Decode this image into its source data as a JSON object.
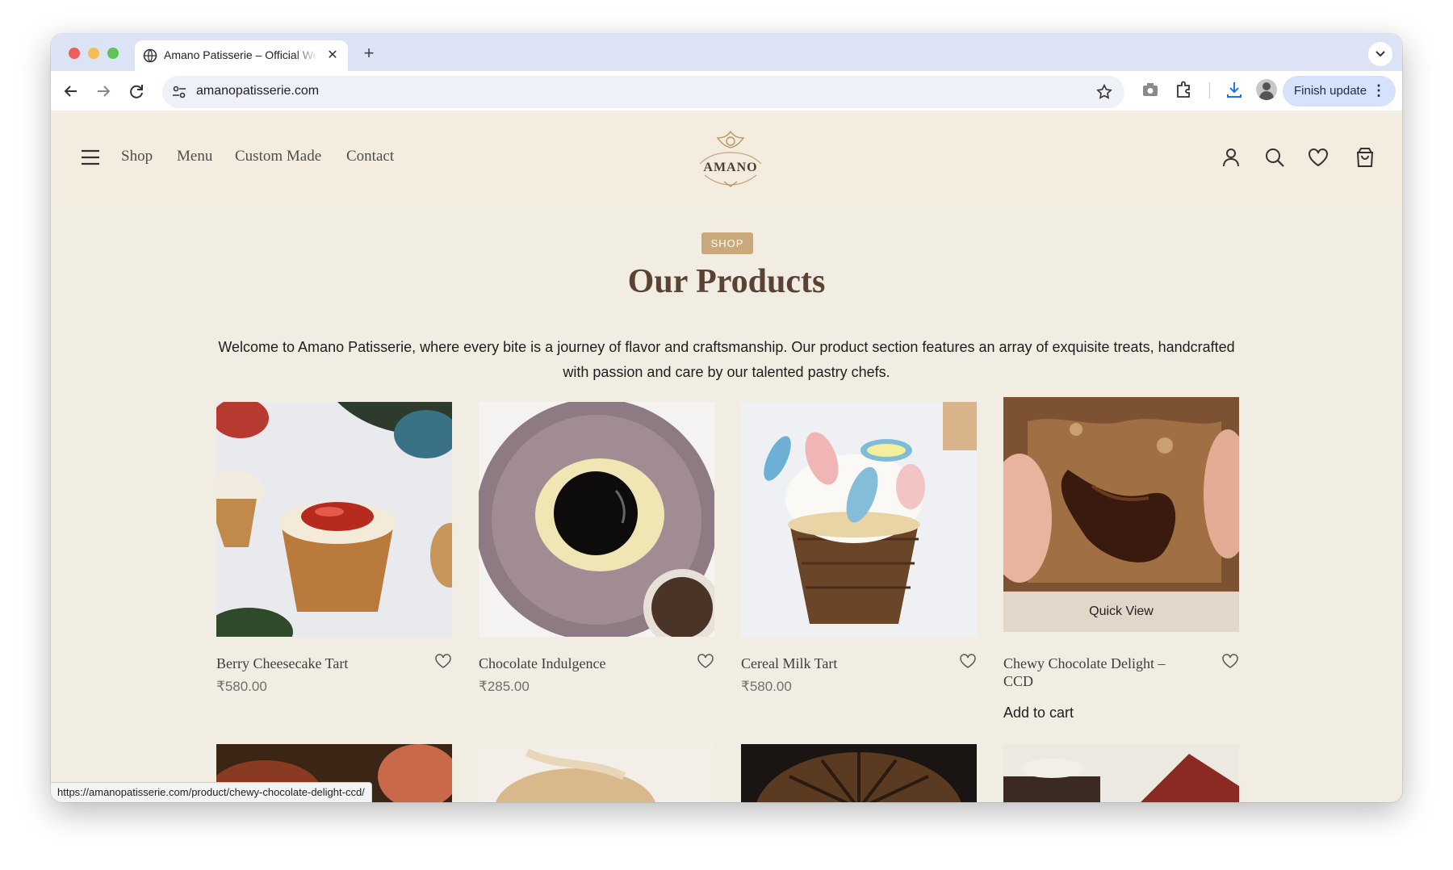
{
  "browser": {
    "tab_title": "Amano Patisserie – Official Website",
    "url": "amanopatisserie.com",
    "finish_update_label": "Finish update",
    "status_url": "https://amanopatisserie.com/product/chewy-chocolate-delight-ccd/"
  },
  "site": {
    "nav": [
      "Shop",
      "Menu",
      "Custom Made",
      "Contact"
    ],
    "logo_text": "AMANO",
    "header_icons": [
      "account-icon",
      "search-icon",
      "wishlist-heart-icon",
      "shopping-bag-icon"
    ]
  },
  "main": {
    "badge": "SHOP",
    "title": "Our Products",
    "intro": "Welcome to Amano Patisserie, where every bite is a journey of flavor and craftsmanship. Our product section features an array of exquisite treats, handcrafted with passion and care by our talented pastry chefs.",
    "quick_view_label": "Quick View",
    "products": [
      {
        "name": "Berry Cheesecake Tart",
        "price": "₹580.00"
      },
      {
        "name": "Chocolate Indulgence",
        "price": "₹285.00"
      },
      {
        "name": "Cereal Milk Tart",
        "price": "₹580.00"
      },
      {
        "name": "Chewy Chocolate Delight – CCD",
        "action": "Add to cart"
      }
    ]
  },
  "colors": {
    "page_bg": "#f2ede3",
    "header_bg": "#f4ecdf",
    "badge": "#c9a87c",
    "title": "#5a4334"
  }
}
